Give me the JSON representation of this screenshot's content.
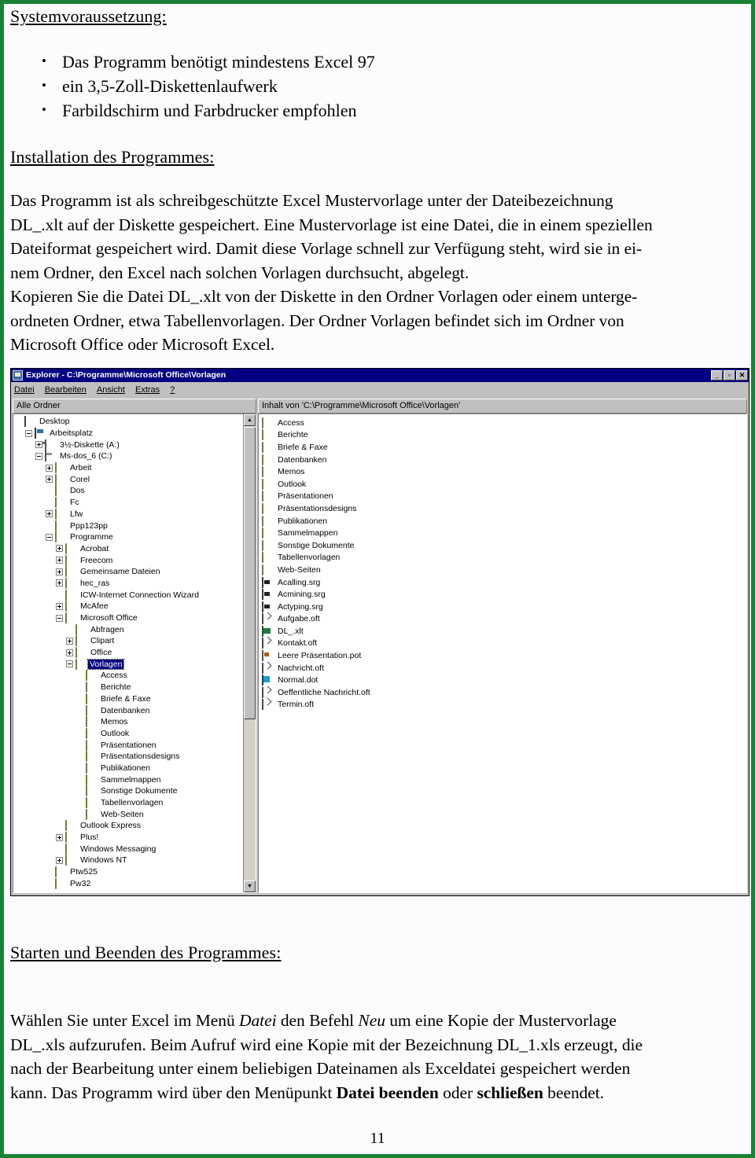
{
  "document": {
    "headings": {
      "system_requirements": "Systemvoraussetzung:",
      "installation": "Installation des Programmes:",
      "start_stop": "Starten und Beenden des Programmes:"
    },
    "requirements_bullets": [
      "Das Programm benötigt mindestens  Excel 97",
      "ein 3,5-Zoll-Diskettenlaufwerk",
      "Farbildschirm und Farbdrucker empfohlen"
    ],
    "installation_paragraph_lines": [
      "Das Programm ist als schreibgeschützte Excel Mustervorlage unter der Dateibezeichnung",
      "DL_.xlt auf der Diskette gespeichert. Eine Mustervorlage ist eine Datei, die in einem speziellen",
      "Dateiformat gespeichert wird. Damit diese Vorlage schnell zur Verfügung steht, wird sie in ei-",
      "nem Ordner, den Excel nach solchen Vorlagen durchsucht, abgelegt.",
      "Kopieren Sie die Datei DL_.xlt von der Diskette in den Ordner Vorlagen oder einem unterge-",
      "ordneten Ordner, etwa Tabellenvorlagen. Der Ordner Vorlagen befindet sich im Ordner von",
      "Microsoft Office oder Microsoft Excel."
    ],
    "start_paragraph": {
      "l1_a": "Wählen Sie unter Excel im Menü ",
      "l1_it1": "Datei",
      "l1_b": " den Befehl ",
      "l1_it2": "Neu",
      "l1_c": " um eine Kopie der Mustervorlage",
      "l2": "DL_.xls aufzurufen. Beim Aufruf wird eine Kopie mit der Bezeichnung DL_1.xls erzeugt, die",
      "l3": "nach der Bearbeitung unter einem beliebigen Dateinamen als Exceldatei gespeichert werden",
      "l4_a": "kann. Das Programm wird über den Menüpunkt ",
      "l4_bd1": "Datei  beenden",
      "l4_b": "  oder  ",
      "l4_bd2": "schließen",
      "l4_c": "  beendet."
    },
    "page_number": "11"
  },
  "explorer": {
    "title": "Explorer - C:\\Programme\\Microsoft Office\\Vorlagen",
    "window_buttons": {
      "minimize": "_",
      "restore": "▫",
      "close": "✕"
    },
    "menu": [
      "Datei",
      "Bearbeiten",
      "Ansicht",
      "Extras",
      "?"
    ],
    "column_headers": {
      "left": "Alle Ordner",
      "right": "Inhalt von 'C:\\Programme\\Microsoft Office\\Vorlagen'"
    },
    "tree": [
      {
        "label": "Desktop",
        "depth": 0,
        "icon": "desktop-icon",
        "toggle": "none",
        "selected": false
      },
      {
        "label": "Arbeitsplatz",
        "depth": 1,
        "icon": "computer-icon",
        "toggle": "minus",
        "selected": false
      },
      {
        "label": "3½-Diskette (A:)",
        "depth": 2,
        "icon": "floppy-drive-icon",
        "toggle": "plus",
        "selected": false
      },
      {
        "label": "Ms-dos_6 (C:)",
        "depth": 2,
        "icon": "hard-drive-icon",
        "toggle": "minus",
        "selected": false
      },
      {
        "label": "Arbeit",
        "depth": 3,
        "icon": "folder-icon",
        "toggle": "plus",
        "selected": false
      },
      {
        "label": "Corel",
        "depth": 3,
        "icon": "folder-icon",
        "toggle": "plus",
        "selected": false
      },
      {
        "label": "Dos",
        "depth": 3,
        "icon": "folder-icon",
        "toggle": "none",
        "selected": false
      },
      {
        "label": "Fc",
        "depth": 3,
        "icon": "folder-icon",
        "toggle": "none",
        "selected": false
      },
      {
        "label": "Lfw",
        "depth": 3,
        "icon": "folder-icon",
        "toggle": "plus",
        "selected": false
      },
      {
        "label": "Ppp123pp",
        "depth": 3,
        "icon": "folder-icon",
        "toggle": "none",
        "selected": false
      },
      {
        "label": "Programme",
        "depth": 3,
        "icon": "folder-icon",
        "toggle": "minus",
        "selected": false
      },
      {
        "label": "Acrobat",
        "depth": 4,
        "icon": "folder-icon",
        "toggle": "plus",
        "selected": false
      },
      {
        "label": "Freecom",
        "depth": 4,
        "icon": "folder-icon",
        "toggle": "plus",
        "selected": false
      },
      {
        "label": "Gemeinsame Dateien",
        "depth": 4,
        "icon": "folder-icon",
        "toggle": "plus",
        "selected": false
      },
      {
        "label": "hec_ras",
        "depth": 4,
        "icon": "folder-icon",
        "toggle": "plus",
        "selected": false
      },
      {
        "label": "ICW-Internet Connection Wizard",
        "depth": 4,
        "icon": "folder-icon",
        "toggle": "none",
        "selected": false
      },
      {
        "label": "McAfee",
        "depth": 4,
        "icon": "folder-icon",
        "toggle": "plus",
        "selected": false
      },
      {
        "label": "Microsoft Office",
        "depth": 4,
        "icon": "folder-icon",
        "toggle": "minus",
        "selected": false
      },
      {
        "label": "Abfragen",
        "depth": 5,
        "icon": "folder-icon",
        "toggle": "none",
        "selected": false
      },
      {
        "label": "Clipart",
        "depth": 5,
        "icon": "folder-icon",
        "toggle": "plus",
        "selected": false
      },
      {
        "label": "Office",
        "depth": 5,
        "icon": "folder-icon",
        "toggle": "plus",
        "selected": false
      },
      {
        "label": "Vorlagen",
        "depth": 5,
        "icon": "folder-open-icon",
        "toggle": "minus",
        "selected": true
      },
      {
        "label": "Access",
        "depth": 6,
        "icon": "folder-icon",
        "toggle": "none",
        "selected": false
      },
      {
        "label": "Berichte",
        "depth": 6,
        "icon": "folder-icon",
        "toggle": "none",
        "selected": false
      },
      {
        "label": "Briefe & Faxe",
        "depth": 6,
        "icon": "folder-icon",
        "toggle": "none",
        "selected": false
      },
      {
        "label": "Datenbanken",
        "depth": 6,
        "icon": "folder-icon",
        "toggle": "none",
        "selected": false
      },
      {
        "label": "Memos",
        "depth": 6,
        "icon": "folder-icon",
        "toggle": "none",
        "selected": false
      },
      {
        "label": "Outlook",
        "depth": 6,
        "icon": "folder-icon",
        "toggle": "none",
        "selected": false
      },
      {
        "label": "Präsentationen",
        "depth": 6,
        "icon": "folder-icon",
        "toggle": "none",
        "selected": false
      },
      {
        "label": "Präsentationsdesigns",
        "depth": 6,
        "icon": "folder-icon",
        "toggle": "none",
        "selected": false
      },
      {
        "label": "Publikationen",
        "depth": 6,
        "icon": "folder-icon",
        "toggle": "none",
        "selected": false
      },
      {
        "label": "Sammelmappen",
        "depth": 6,
        "icon": "folder-icon",
        "toggle": "none",
        "selected": false
      },
      {
        "label": "Sonstige Dokumente",
        "depth": 6,
        "icon": "folder-icon",
        "toggle": "none",
        "selected": false
      },
      {
        "label": "Tabellenvorlagen",
        "depth": 6,
        "icon": "folder-icon",
        "toggle": "none",
        "selected": false
      },
      {
        "label": "Web-Seiten",
        "depth": 6,
        "icon": "folder-icon",
        "toggle": "none",
        "selected": false
      },
      {
        "label": "Outlook Express",
        "depth": 4,
        "icon": "folder-icon",
        "toggle": "none",
        "selected": false
      },
      {
        "label": "Plus!",
        "depth": 4,
        "icon": "folder-icon",
        "toggle": "plus",
        "selected": false
      },
      {
        "label": "Windows Messaging",
        "depth": 4,
        "icon": "folder-icon",
        "toggle": "none",
        "selected": false
      },
      {
        "label": "Windows NT",
        "depth": 4,
        "icon": "folder-icon",
        "toggle": "plus",
        "selected": false
      },
      {
        "label": "Ptw525",
        "depth": 3,
        "icon": "folder-icon",
        "toggle": "none",
        "selected": false
      },
      {
        "label": "Pw32",
        "depth": 3,
        "icon": "folder-icon",
        "toggle": "none",
        "selected": false
      }
    ],
    "files": [
      {
        "label": "Access",
        "icon": "folder-icon"
      },
      {
        "label": "Berichte",
        "icon": "folder-icon"
      },
      {
        "label": "Briefe & Faxe",
        "icon": "folder-icon"
      },
      {
        "label": "Datenbanken",
        "icon": "folder-icon"
      },
      {
        "label": "Memos",
        "icon": "folder-icon"
      },
      {
        "label": "Outlook",
        "icon": "folder-icon"
      },
      {
        "label": "Präsentationen",
        "icon": "folder-icon"
      },
      {
        "label": "Präsentationsdesigns",
        "icon": "folder-icon"
      },
      {
        "label": "Publikationen",
        "icon": "folder-icon"
      },
      {
        "label": "Sammelmappen",
        "icon": "folder-icon"
      },
      {
        "label": "Sonstige Dokumente",
        "icon": "folder-icon"
      },
      {
        "label": "Tabellenvorlagen",
        "icon": "folder-icon"
      },
      {
        "label": "Web-Seiten",
        "icon": "folder-icon"
      },
      {
        "label": "Acalling.srg",
        "icon": "srg-file-icon"
      },
      {
        "label": "Acmining.srg",
        "icon": "srg-file-icon"
      },
      {
        "label": "Actyping.srg",
        "icon": "srg-file-icon"
      },
      {
        "label": "Aufgabe.oft",
        "icon": "outlook-template-icon"
      },
      {
        "label": "DL_.xlt",
        "icon": "excel-template-icon"
      },
      {
        "label": "Kontakt.oft",
        "icon": "outlook-template-icon"
      },
      {
        "label": "Leere Präsentation.pot",
        "icon": "powerpoint-template-icon"
      },
      {
        "label": "Nachricht.oft",
        "icon": "outlook-template-icon"
      },
      {
        "label": "Normal.dot",
        "icon": "word-template-icon"
      },
      {
        "label": "Oeffentliche Nachricht.oft",
        "icon": "outlook-template-icon"
      },
      {
        "label": "Termin.oft",
        "icon": "outlook-template-icon"
      }
    ],
    "scrollbar": {
      "up_arrow": "▲",
      "down_arrow": "▼"
    }
  },
  "colors": {
    "page_border": "#1a8236",
    "titlebar": "#000080",
    "selection": "#000080",
    "window_face": "#c0c0c0",
    "folder": "#e8dc74"
  }
}
